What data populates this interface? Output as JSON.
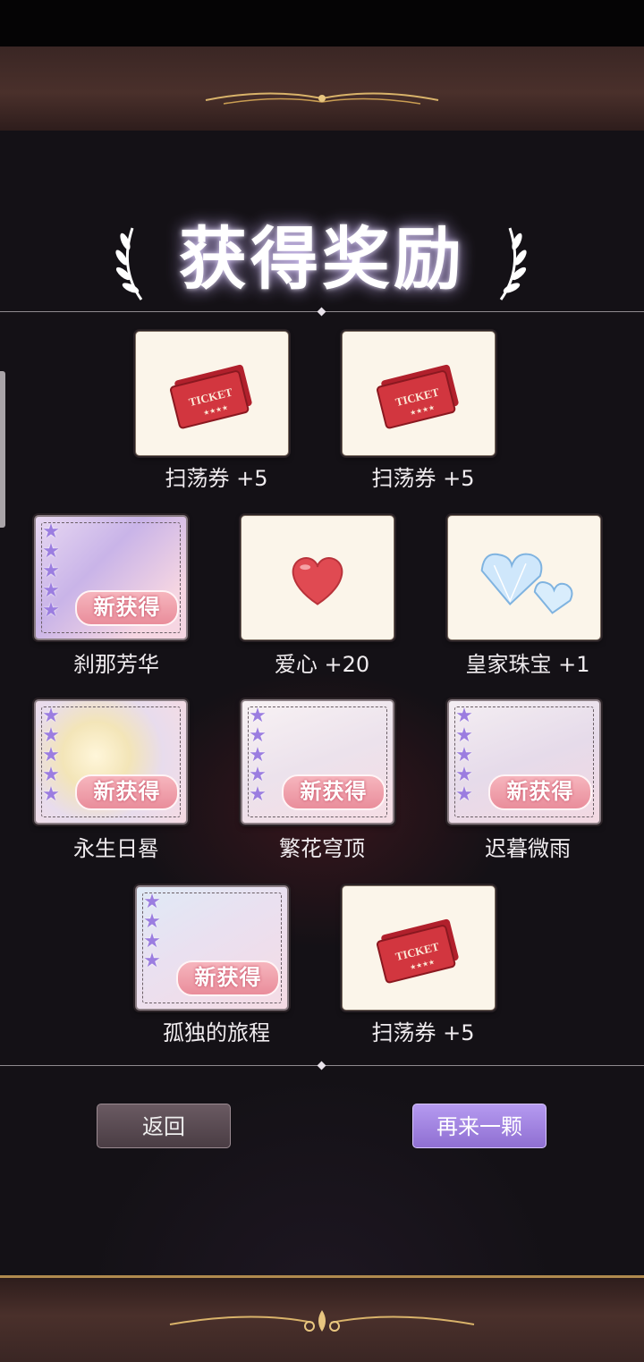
{
  "title": "获得奖励",
  "rewards": [
    {
      "label": "扫荡券 +5",
      "icon": "ticket-icon",
      "new_badge": ""
    },
    {
      "label": "扫荡券 +5",
      "icon": "ticket-icon",
      "new_badge": ""
    },
    {
      "label": "刹那芳华",
      "icon": "outfit-card-art",
      "new_badge": "新获得",
      "stars": 5
    },
    {
      "label": "爱心 +20",
      "icon": "heart-icon",
      "new_badge": ""
    },
    {
      "label": "皇家珠宝 +1",
      "icon": "jewel-icon",
      "new_badge": ""
    },
    {
      "label": "永生日晷",
      "icon": "outfit-card-art",
      "new_badge": "新获得",
      "stars": 5
    },
    {
      "label": "繁花穹顶",
      "icon": "outfit-card-art",
      "new_badge": "新获得",
      "stars": 5
    },
    {
      "label": "迟暮微雨",
      "icon": "outfit-card-art",
      "new_badge": "新获得",
      "stars": 5
    },
    {
      "label": "孤独的旅程",
      "icon": "outfit-card-art",
      "new_badge": "新获得",
      "stars": 4
    },
    {
      "label": "扫荡券 +5",
      "icon": "ticket-icon",
      "new_badge": ""
    }
  ],
  "ticket_text": "TICKET",
  "buttons": {
    "back": "返回",
    "again": "再来一颗"
  },
  "colors": {
    "accent_purple": "#9b7de0",
    "gold": "#b08a4e",
    "badge_pink": "#e98d9b"
  }
}
